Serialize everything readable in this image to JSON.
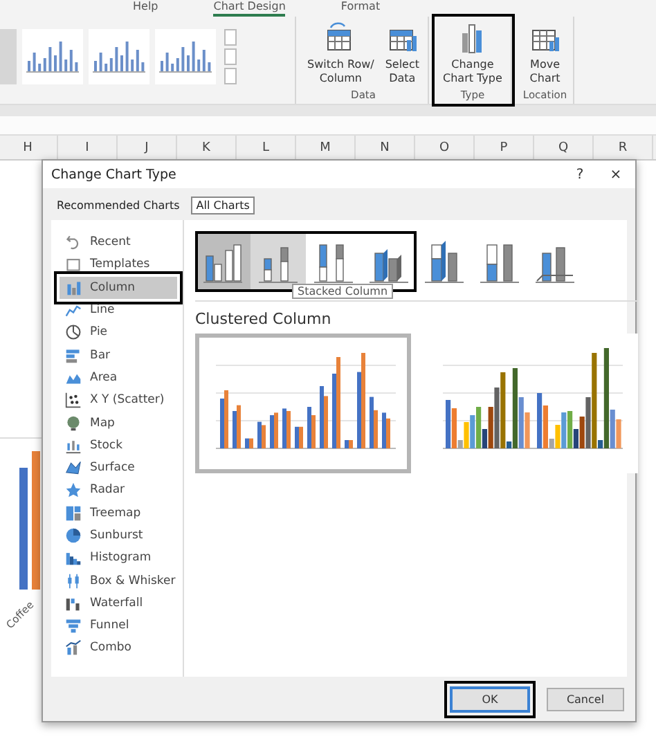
{
  "ribbon": {
    "tabs": [
      {
        "label": "Help",
        "selected": false
      },
      {
        "label": "Chart Design",
        "selected": true
      },
      {
        "label": "Format",
        "selected": false
      }
    ],
    "style_gallery": [
      {
        "selected": true
      },
      {
        "selected": false
      },
      {
        "selected": false
      },
      {
        "selected": false
      }
    ],
    "groups": [
      {
        "label": "Data",
        "highlighted": false,
        "buttons": [
          {
            "kind": "switch",
            "lines": [
              "Switch Row/",
              "Column"
            ]
          },
          {
            "kind": "select",
            "lines": [
              "Select",
              "Data"
            ]
          }
        ]
      },
      {
        "label": "Type",
        "highlighted": true,
        "buttons": [
          {
            "kind": "change",
            "lines": [
              "Change",
              "Chart Type"
            ]
          }
        ]
      },
      {
        "label": "Location",
        "highlighted": false,
        "buttons": [
          {
            "kind": "move",
            "lines": [
              "Move",
              "Chart"
            ]
          }
        ]
      }
    ]
  },
  "sheet": {
    "columns": [
      "H",
      "I",
      "J",
      "K",
      "L",
      "M",
      "N",
      "O",
      "P",
      "Q",
      "R"
    ],
    "chart_label": "Coffee"
  },
  "dialog": {
    "title": "Change Chart Type",
    "help": "?",
    "close": "×",
    "tabs": [
      {
        "label": "Recommended Charts",
        "selected": false
      },
      {
        "label": "All Charts",
        "selected": true
      }
    ],
    "chart_types": [
      {
        "kind": "recent",
        "label": "Recent",
        "selected": false,
        "highlighted": false
      },
      {
        "kind": "templates",
        "label": "Templates",
        "selected": false,
        "highlighted": false
      },
      {
        "kind": "column",
        "label": "Column",
        "selected": true,
        "highlighted": true
      },
      {
        "kind": "line",
        "label": "Line",
        "selected": false,
        "highlighted": false
      },
      {
        "kind": "pie",
        "label": "Pie",
        "selected": false,
        "highlighted": false
      },
      {
        "kind": "bar",
        "label": "Bar",
        "selected": false,
        "highlighted": false
      },
      {
        "kind": "area",
        "label": "Area",
        "selected": false,
        "highlighted": false
      },
      {
        "kind": "scatter",
        "label": "X Y (Scatter)",
        "selected": false,
        "highlighted": false
      },
      {
        "kind": "map",
        "label": "Map",
        "selected": false,
        "highlighted": false
      },
      {
        "kind": "stock",
        "label": "Stock",
        "selected": false,
        "highlighted": false
      },
      {
        "kind": "surface",
        "label": "Surface",
        "selected": false,
        "highlighted": false
      },
      {
        "kind": "radar",
        "label": "Radar",
        "selected": false,
        "highlighted": false
      },
      {
        "kind": "treemap",
        "label": "Treemap",
        "selected": false,
        "highlighted": false
      },
      {
        "kind": "sunburst",
        "label": "Sunburst",
        "selected": false,
        "highlighted": false
      },
      {
        "kind": "histogram",
        "label": "Histogram",
        "selected": false,
        "highlighted": false
      },
      {
        "kind": "box",
        "label": "Box & Whisker",
        "selected": false,
        "highlighted": false
      },
      {
        "kind": "waterfall",
        "label": "Waterfall",
        "selected": false,
        "highlighted": false
      },
      {
        "kind": "funnel",
        "label": "Funnel",
        "selected": false,
        "highlighted": false
      },
      {
        "kind": "combo",
        "label": "Combo",
        "selected": false,
        "highlighted": false
      }
    ],
    "subtypes": [
      {
        "kind": "clustered",
        "selected": true,
        "hovered": false,
        "highlighted": true
      },
      {
        "kind": "stacked",
        "selected": false,
        "hovered": true,
        "highlighted": true
      },
      {
        "kind": "full",
        "selected": false,
        "hovered": false,
        "highlighted": true
      },
      {
        "kind": "clustered3d",
        "selected": false,
        "hovered": false,
        "highlighted": true
      },
      {
        "kind": "stacked3d",
        "selected": false,
        "hovered": false,
        "highlighted": false
      },
      {
        "kind": "full3d",
        "selected": false,
        "hovered": false,
        "highlighted": false
      },
      {
        "kind": "column3d",
        "selected": false,
        "hovered": false,
        "highlighted": false
      }
    ],
    "tooltip": "Stacked Column",
    "subtype_title": "Clustered Column",
    "previews": [
      {
        "kind": "by-category",
        "selected": true
      },
      {
        "kind": "by-series",
        "selected": false
      }
    ],
    "buttons": [
      {
        "label": "OK",
        "default": true,
        "highlighted": true
      },
      {
        "label": "Cancel",
        "default": false,
        "highlighted": false
      }
    ]
  }
}
